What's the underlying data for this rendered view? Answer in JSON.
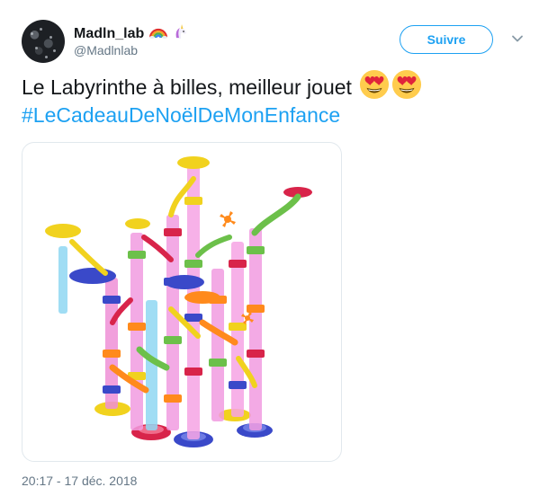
{
  "author": {
    "display_name": "Madln_lab",
    "handle": "@Madlnlab",
    "name_emojis": [
      "rainbow-emoji",
      "unicorn-emoji"
    ]
  },
  "follow_button": {
    "label": "Suivre"
  },
  "tweet": {
    "text": "Le Labyrinthe à billes, meilleur jouet",
    "text_emojis": [
      "heart-eyes-emoji",
      "heart-eyes-emoji"
    ],
    "hashtag": "#LeCadeauDeNoëlDeMonEnfance"
  },
  "media": {
    "description_icon": "marble-run-toy-image"
  },
  "timestamp": "20:17 - 17 déc. 2018",
  "colors": {
    "accent": "#1da1f2",
    "text": "#14171a",
    "muted": "#657786",
    "border": "#e1e8ed"
  }
}
